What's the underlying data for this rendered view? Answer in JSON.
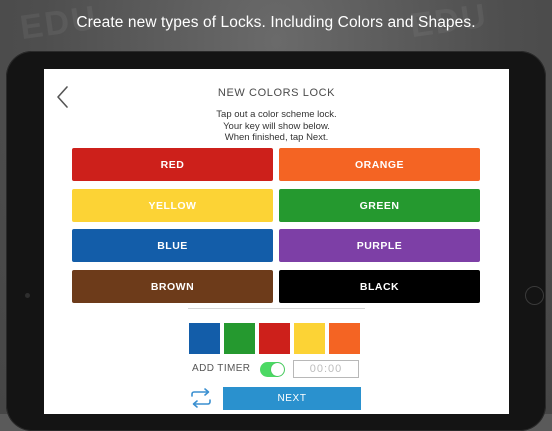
{
  "caption": "Create new types of Locks. Including Colors and Shapes.",
  "header": {
    "title": "NEW COLORS LOCK",
    "back_icon": "chevron-left-icon"
  },
  "instructions": [
    "Tap out a color scheme lock.",
    "Your key will show below.",
    "When finished, tap Next."
  ],
  "color_buttons": [
    {
      "label": "RED",
      "color": "#cd201b"
    },
    {
      "label": "ORANGE",
      "color": "#f46423"
    },
    {
      "label": "YELLOW",
      "color": "#fcd335"
    },
    {
      "label": "GREEN",
      "color": "#25992f"
    },
    {
      "label": "BLUE",
      "color": "#135da9"
    },
    {
      "label": "PURPLE",
      "color": "#7d3fa6"
    },
    {
      "label": "BROWN",
      "color": "#6d3b1a"
    },
    {
      "label": "BLACK",
      "color": "#000000"
    }
  ],
  "key_sequence": [
    {
      "color": "#135da9"
    },
    {
      "color": "#25992f"
    },
    {
      "color": "#cd201b"
    },
    {
      "color": "#fcd335"
    },
    {
      "color": "#f46423"
    }
  ],
  "timer": {
    "label": "ADD TIMER",
    "enabled": true,
    "placeholder": "00:00"
  },
  "footer": {
    "repeat_icon": "repeat-icon",
    "next_label": "NEXT",
    "next_color": "#2a91ce"
  }
}
